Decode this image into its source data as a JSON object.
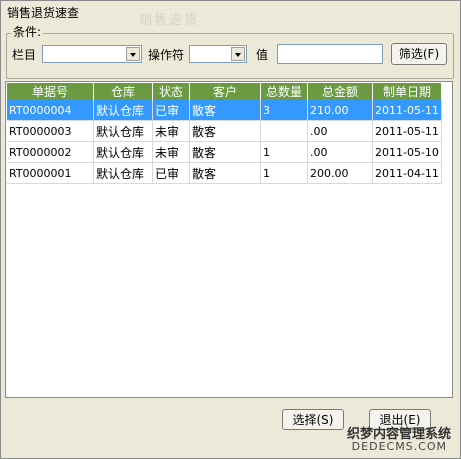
{
  "window": {
    "title": "销售退货速查",
    "bg_ghost_text": "销售退货"
  },
  "filter": {
    "group_label": "条件:",
    "column_label": "栏目",
    "column_value": "",
    "operator_label": "操作符",
    "operator_value": "",
    "value_label": "值",
    "value_input": "",
    "filter_button": "筛选(F)"
  },
  "table": {
    "headers": [
      "单据号",
      "仓库",
      "状态",
      "客户",
      "总数量",
      "总金额",
      "制单日期"
    ],
    "rows": [
      {
        "id": "RT0000004",
        "warehouse": "默认仓库",
        "status": "已审",
        "customer": "散客",
        "qty": "3",
        "amount": "210.00",
        "date": "2011-05-11"
      },
      {
        "id": "RT0000003",
        "warehouse": "默认仓库",
        "status": "未审",
        "customer": "散客",
        "qty": "",
        "amount": ".00",
        "date": "2011-05-11"
      },
      {
        "id": "RT0000002",
        "warehouse": "默认仓库",
        "status": "未审",
        "customer": "散客",
        "qty": "1",
        "amount": ".00",
        "date": "2011-05-10"
      },
      {
        "id": "RT0000001",
        "warehouse": "默认仓库",
        "status": "已审",
        "customer": "散客",
        "qty": "1",
        "amount": "200.00",
        "date": "2011-04-11"
      }
    ],
    "selected_row": 0
  },
  "buttons": {
    "select": "选择(S)",
    "exit": "退出(E)"
  },
  "watermark": {
    "line1": "织梦内容管理系统",
    "line2": "DEDECMS.COM"
  }
}
